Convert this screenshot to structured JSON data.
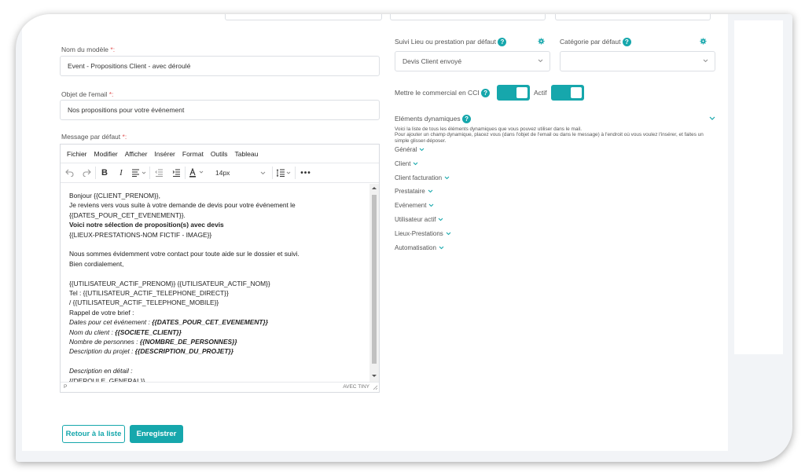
{
  "colors": {
    "accent": "#16a7ac",
    "required": "#e05555"
  },
  "form": {
    "model_name": {
      "label": "Nom du modèle",
      "req": "*:",
      "value": "Event - Propositions Client - avec déroulé"
    },
    "email_subject": {
      "label": "Objet de l'email",
      "req": "*:",
      "value": "Nos propositions pour votre événement"
    },
    "default_message": {
      "label": "Message par défaut",
      "req": "*:"
    }
  },
  "editor": {
    "menus": [
      "Fichier",
      "Modifier",
      "Afficher",
      "Insérer",
      "Format",
      "Outils",
      "Tableau"
    ],
    "font_size": "14px",
    "status_path": "P",
    "branding": "AVEC TINY",
    "lines": [
      {
        "t": "Bonjour {{CLIENT_PRENOM}},"
      },
      {
        "t": "Je reviens vers vous suite à votre demande de devis pour votre événement le"
      },
      {
        "t": "{{DATES_POUR_CET_EVENEMENT}}."
      },
      {
        "t": "Voici notre sélection de proposition(s) avec devis",
        "b": true
      },
      {
        "t": "{{LIEUX-PRESTATIONS-NOM FICTIF - IMAGE}}"
      },
      {
        "t": ""
      },
      {
        "t": "Nous sommes évidemment votre contact pour toute aide sur le dossier et suivi."
      },
      {
        "t": "Bien cordialement,"
      },
      {
        "t": ""
      },
      {
        "t": "{{UTILISATEUR_ACTIF_PRENOM}} {{UTILISATEUR_ACTIF_NOM}}"
      },
      {
        "t": "Tel : {{UTILISATEUR_ACTIF_TELEPHONE_DIRECT}}"
      },
      {
        "t": "/ {{UTILISATEUR_ACTIF_TELEPHONE_MOBILE}}"
      },
      {
        "t": "Rappel de votre brief :"
      },
      {
        "i": "Dates pour cet événement : ",
        "bi": "{{DATES_POUR_CET_EVENEMENT}}"
      },
      {
        "i": "Nom du client : ",
        "bi": "{{SOCIETE_CLIENT}}"
      },
      {
        "i": "Nombre de personnes : ",
        "bi": "{{NOMBRE_DE_PERSONNES}}"
      },
      {
        "i": "Description du projet : ",
        "bi": "{{DESCRIPTION_DU_PROJET}}"
      },
      {
        "t": ""
      },
      {
        "i": "Description en détail :"
      },
      {
        "t": "{{DEROULE_GENERAL}}"
      }
    ]
  },
  "right": {
    "suivi": {
      "label": "Suivi Lieu ou prestation par défaut",
      "value": "Devis Client envoyé"
    },
    "categorie": {
      "label": "Catégorie par défaut",
      "value": ""
    },
    "cc_label": "Mettre le commercial en CCI",
    "actif_label": "Actif",
    "dynamic": {
      "title": "Eléments dynamiques",
      "desc1": "Voici la liste de tous les éléments dynamiques que vous pouvez utiliser dans le mail.",
      "desc2": "Pour ajouter un champ dynamique, placez vous (dans l'objet de l'email ou dans le message) à l'endroit où vous voulez l'insérer, et faites un simple glisser-déposer.",
      "items": [
        "Général",
        "Client",
        "Client facturation",
        "Prestataire",
        "Evénement",
        "Utilisateur actif",
        "Lieux-Prestations",
        "Automatisation"
      ]
    }
  },
  "buttons": {
    "back": "Retour à la liste",
    "save": "Enregistrer"
  }
}
